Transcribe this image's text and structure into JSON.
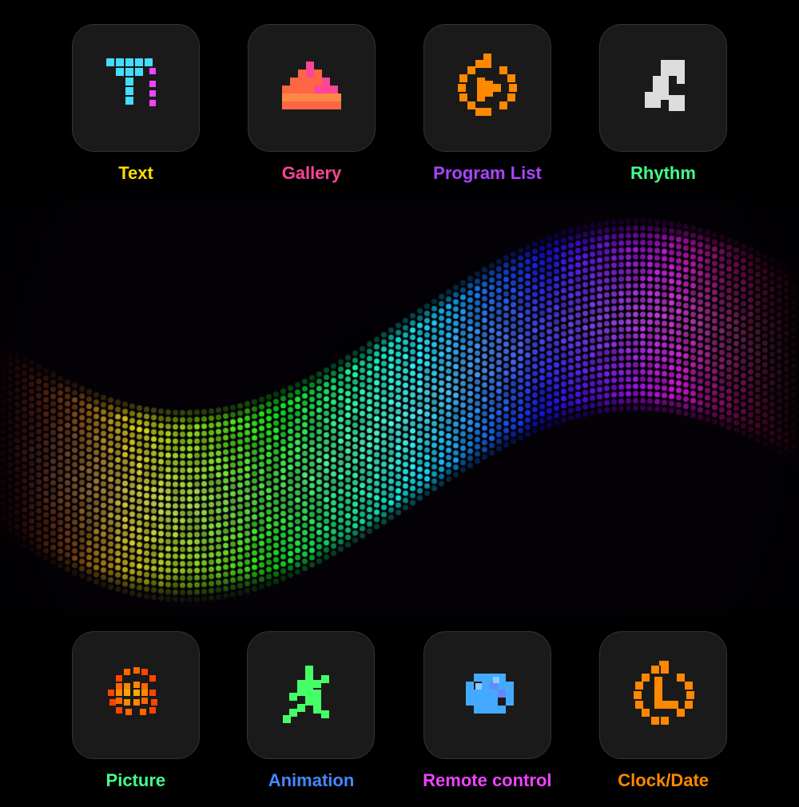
{
  "top_items": [
    {
      "id": "text",
      "label": "Text",
      "color": "#ffdd00",
      "icon": "text"
    },
    {
      "id": "gallery",
      "label": "Gallery",
      "color": "#ff4499",
      "icon": "gallery"
    },
    {
      "id": "program-list",
      "label": "Program List",
      "color": "#aa44ff",
      "icon": "program-list"
    },
    {
      "id": "rhythm",
      "label": "Rhythm",
      "color": "#44ff88",
      "icon": "rhythm"
    }
  ],
  "bottom_items": [
    {
      "id": "picture",
      "label": "Picture",
      "color": "#44ff88",
      "icon": "picture"
    },
    {
      "id": "animation",
      "label": "Animation",
      "color": "#4488ff",
      "icon": "animation"
    },
    {
      "id": "remote-control",
      "label": "Remote control",
      "color": "#ee44ff",
      "icon": "remote-control"
    },
    {
      "id": "clock-date",
      "label": "Clock/Date",
      "color": "#ff8800",
      "icon": "clock-date"
    }
  ]
}
